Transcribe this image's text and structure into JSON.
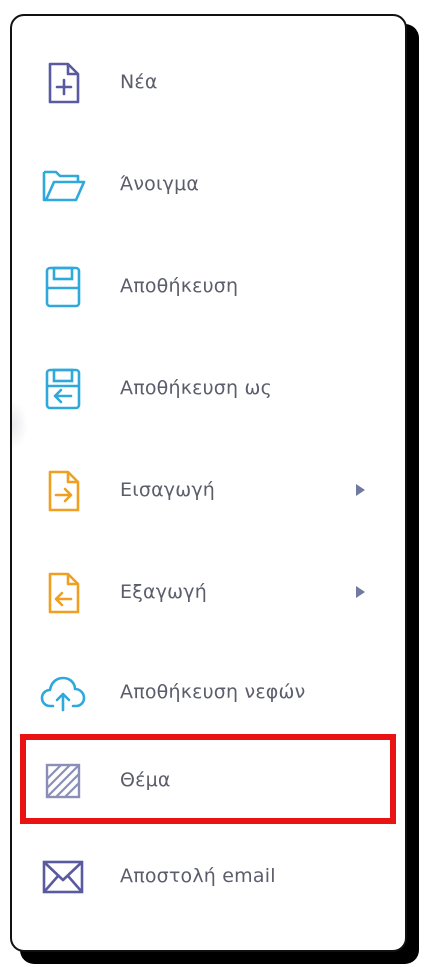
{
  "colors": {
    "purple": "#5a5aa0",
    "blue": "#2fa8dc",
    "orange": "#f0a020",
    "highlight": "#ea1313",
    "label": "#5b5d6b"
  },
  "menu": {
    "items": [
      {
        "label": "Νέα",
        "icon": "new-file-icon"
      },
      {
        "label": "Άνοιγμα",
        "icon": "open-folder-icon"
      },
      {
        "label": "Αποθήκευση",
        "icon": "save-icon"
      },
      {
        "label": "Αποθήκευση ως",
        "icon": "save-as-icon"
      },
      {
        "label": "Εισαγωγή",
        "icon": "import-icon",
        "submenu": true
      },
      {
        "label": "Εξαγωγή",
        "icon": "export-icon",
        "submenu": true
      },
      {
        "label": "Αποθήκευση νεφών",
        "icon": "cloud-upload-icon"
      },
      {
        "label": "Θέμα",
        "icon": "theme-icon",
        "highlighted": true
      },
      {
        "label": "Αποστολή email",
        "icon": "email-icon"
      }
    ]
  }
}
